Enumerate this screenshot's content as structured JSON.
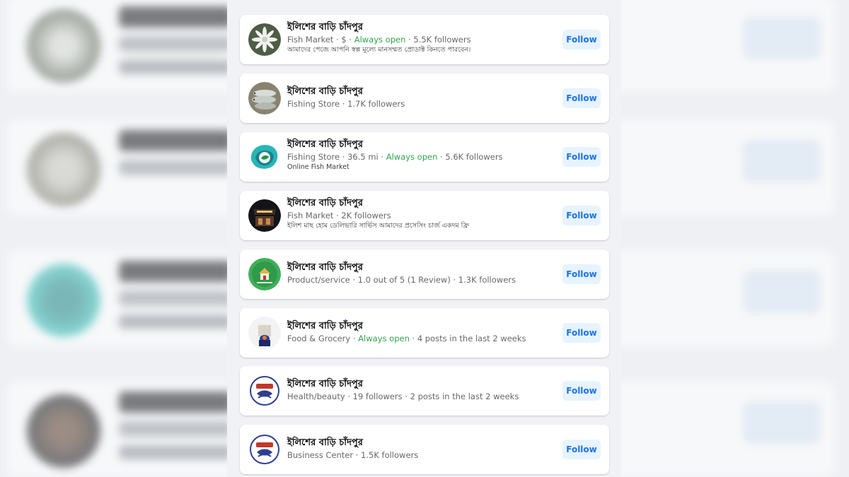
{
  "colors": {
    "accent": "#1b74e4",
    "open": "#31a24c",
    "meta": "#65676b"
  },
  "results": [
    {
      "name": "ইলিশের বাড়ি চাঁদপুর",
      "category": "Fish Market",
      "price": "$",
      "status": "Always open",
      "stats": "5.5K followers",
      "description": "আমাদের পেজে আপনি স্বল্প মূল্যে মানসম্মত প্রোডাক্ট কিনতে পারবেন।",
      "follow_label": "Follow",
      "avatar_icon": "fish-white-icon"
    },
    {
      "name": "ইলিশের বাড়ি চাঁদপুর",
      "category": "Fishing Store",
      "stats": "1.7K followers",
      "follow_label": "Follow",
      "avatar_icon": "hilsa-fish-icon"
    },
    {
      "name": "ইলিশের বাড়ি চাঁদপুর",
      "category": "Fishing Store",
      "distance": "36.5 mi",
      "status": "Always open",
      "stats": "5.6K followers",
      "description": "Online Fish Market",
      "follow_label": "Follow",
      "avatar_icon": "teal-splash-logo-icon"
    },
    {
      "name": "ইলিশের বাড়ি চাঁদপুর",
      "category": "Fish Market",
      "stats": "2K followers",
      "description": "ইলিশ মাছ হোম ডেলিভারি সার্ভিস আমাদের প্রসেসিং চার্জ একদম ফ্রি",
      "follow_label": "Follow",
      "avatar_icon": "night-shop-icon"
    },
    {
      "name": "ইলিশের বাড়ি চাঁদপুর",
      "category": "Product/service",
      "rating": "1.0 out of 5 (1 Review)",
      "stats": "1.3K followers",
      "follow_label": "Follow",
      "avatar_icon": "green-house-logo-icon"
    },
    {
      "name": "ইলিশের বাড়ি চাঁদপুর",
      "category": "Food & Grocery",
      "status": "Always open",
      "stats": "4 posts in the last 2 weeks",
      "follow_label": "Follow",
      "avatar_icon": "person-icon"
    },
    {
      "name": "ইলিশের বাড়ি চাঁদপুর",
      "category": "Health/beauty",
      "stats": "19 followers",
      "stats2": "2 posts in the last 2 weeks",
      "follow_label": "Follow",
      "avatar_icon": "round-fish-emblem-icon"
    },
    {
      "name": "ইলিশের বাড়ি চাঁদপুর",
      "category": "Business Center",
      "stats": "1.5K followers",
      "follow_label": "Follow",
      "avatar_icon": "round-fish-emblem-icon"
    }
  ]
}
